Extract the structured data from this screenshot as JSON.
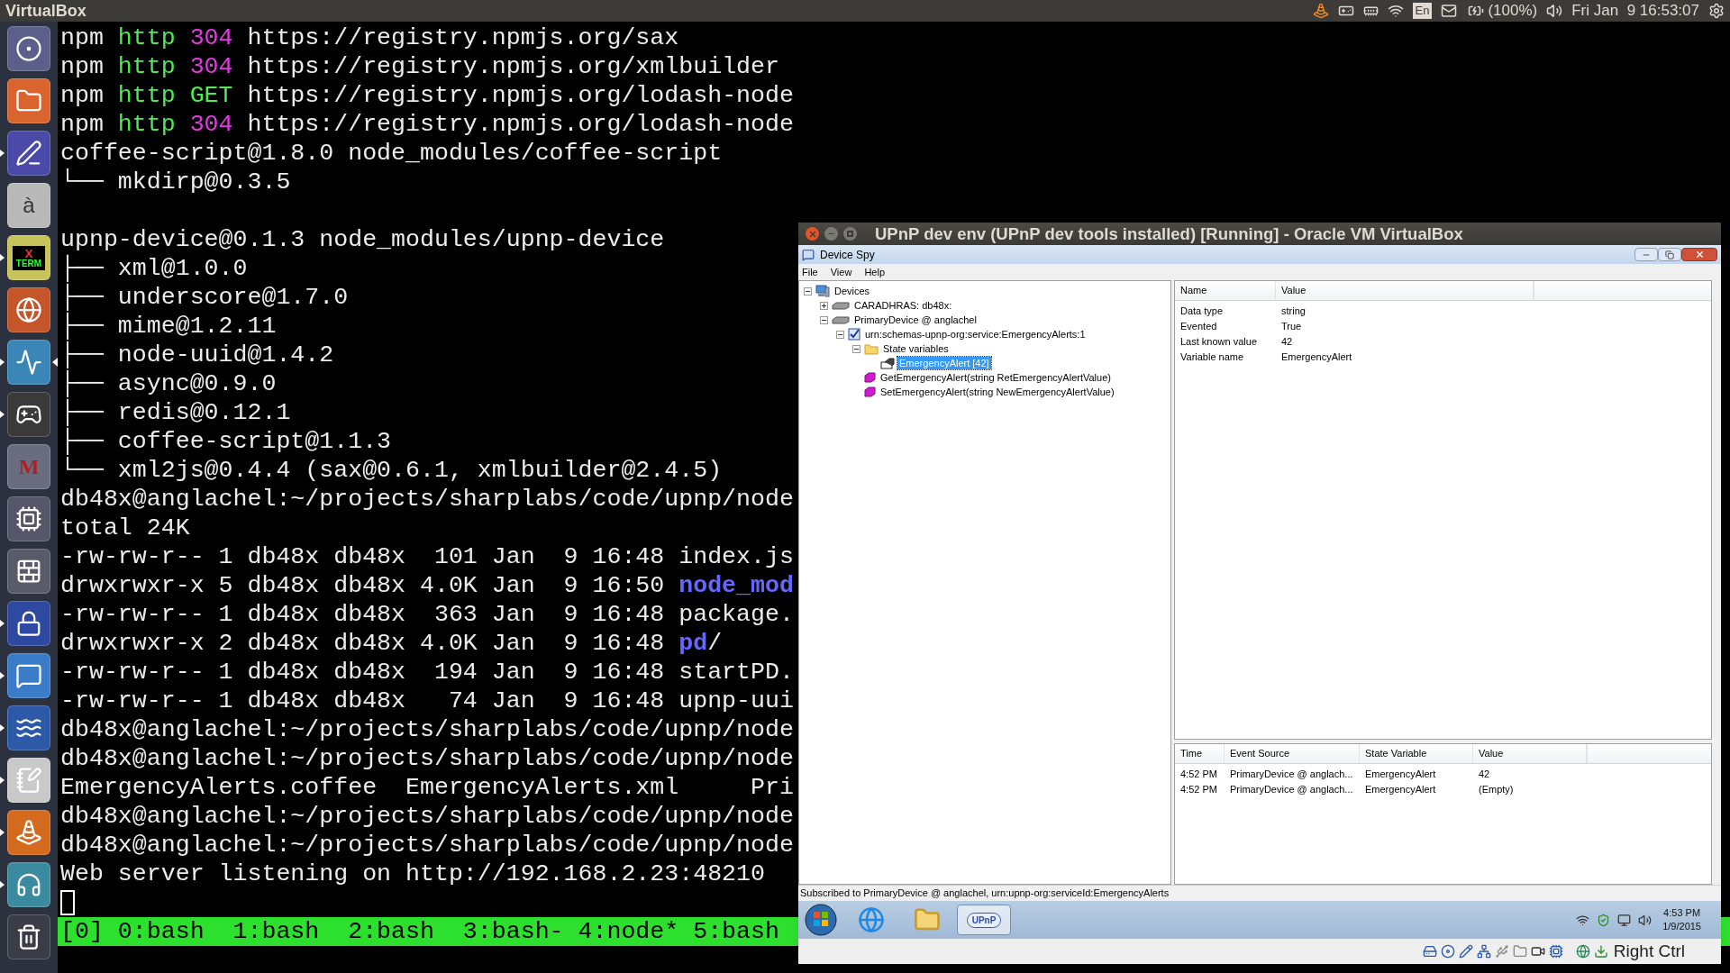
{
  "top_panel": {
    "app_title": "VirtualBox",
    "keyboard_layout": "En",
    "battery": "(100%)",
    "clock": "Fri Jan  9 16:53:07"
  },
  "launcher": {
    "items": [
      {
        "kind": "dash",
        "running": false,
        "focused": false
      },
      {
        "kind": "files",
        "running": false,
        "focused": false
      },
      {
        "kind": "editor",
        "running": true,
        "focused": false
      },
      {
        "kind": "font",
        "label": "à",
        "running": false,
        "focused": false
      },
      {
        "kind": "xterm",
        "label": "X",
        "sublabel": "TERM",
        "running": true,
        "focused": false
      },
      {
        "kind": "browser",
        "running": false,
        "focused": false
      },
      {
        "kind": "monitor",
        "running": true,
        "focused": true
      },
      {
        "kind": "steam",
        "running": true,
        "focused": false
      },
      {
        "kind": "maple",
        "label": "M",
        "running": false,
        "focused": false
      },
      {
        "kind": "circuit",
        "running": false,
        "focused": false
      },
      {
        "kind": "firewall",
        "running": false,
        "focused": false
      },
      {
        "kind": "keepass",
        "running": true,
        "focused": false
      },
      {
        "kind": "chat",
        "running": true,
        "focused": false
      },
      {
        "kind": "shark",
        "running": true,
        "focused": false
      },
      {
        "kind": "notes",
        "running": true,
        "focused": false
      },
      {
        "kind": "vlc",
        "running": true,
        "focused": false
      },
      {
        "kind": "teamspeak",
        "running": true,
        "focused": false
      },
      {
        "kind": "trash",
        "running": false,
        "focused": false
      }
    ]
  },
  "terminal": {
    "lines": [
      {
        "kind": "text",
        "segments": [
          {
            "text": "npm ",
            "kind": "plain"
          },
          {
            "text": "http ",
            "kind": "http"
          },
          {
            "text": "304 ",
            "kind": "code"
          },
          {
            "text": "https://registry.npmjs.org/sax",
            "kind": "plain"
          }
        ]
      },
      {
        "kind": "text",
        "segments": [
          {
            "text": "npm ",
            "kind": "plain"
          },
          {
            "text": "http ",
            "kind": "http"
          },
          {
            "text": "304 ",
            "kind": "code"
          },
          {
            "text": "https://registry.npmjs.org/xmlbuilder",
            "kind": "plain"
          }
        ]
      },
      {
        "kind": "text",
        "segments": [
          {
            "text": "npm ",
            "kind": "plain"
          },
          {
            "text": "http ",
            "kind": "http"
          },
          {
            "text": "GET ",
            "kind": "http"
          },
          {
            "text": "https://registry.npmjs.org/lodash-node",
            "kind": "plain"
          }
        ]
      },
      {
        "kind": "text",
        "segments": [
          {
            "text": "npm ",
            "kind": "plain"
          },
          {
            "text": "http ",
            "kind": "http"
          },
          {
            "text": "304 ",
            "kind": "code"
          },
          {
            "text": "https://registry.npmjs.org/lodash-node",
            "kind": "plain"
          }
        ]
      },
      {
        "kind": "text",
        "segments": [
          {
            "text": "coffee-script@1.8.0 node_modules/coffee-script",
            "kind": "plain"
          }
        ]
      },
      {
        "kind": "text",
        "segments": [
          {
            "text": "└── mkdirp@0.3.5",
            "kind": "plain"
          }
        ]
      },
      {
        "kind": "blank"
      },
      {
        "kind": "text",
        "segments": [
          {
            "text": "upnp-device@0.1.3 node_modules/upnp-device",
            "kind": "plain"
          }
        ]
      },
      {
        "kind": "text",
        "segments": [
          {
            "text": "├── xml@1.0.0",
            "kind": "plain"
          }
        ]
      },
      {
        "kind": "text",
        "segments": [
          {
            "text": "├── underscore@1.7.0",
            "kind": "plain"
          }
        ]
      },
      {
        "kind": "text",
        "segments": [
          {
            "text": "├── mime@1.2.11",
            "kind": "plain"
          }
        ]
      },
      {
        "kind": "text",
        "segments": [
          {
            "text": "├── node-uuid@1.4.2",
            "kind": "plain"
          }
        ]
      },
      {
        "kind": "text",
        "segments": [
          {
            "text": "├── async@0.9.0",
            "kind": "plain"
          }
        ]
      },
      {
        "kind": "text",
        "segments": [
          {
            "text": "├── redis@0.12.1",
            "kind": "plain"
          }
        ]
      },
      {
        "kind": "text",
        "segments": [
          {
            "text": "├── coffee-script@1.1.3",
            "kind": "plain"
          }
        ]
      },
      {
        "kind": "text",
        "segments": [
          {
            "text": "└── xml2js@0.4.4 (sax@0.6.1, xmlbuilder@2.4.5)",
            "kind": "plain"
          }
        ]
      },
      {
        "kind": "text",
        "segments": [
          {
            "text": "db48x@anglachel:~/projects/sharplabs/code/upnp/node",
            "kind": "plain"
          }
        ]
      },
      {
        "kind": "text",
        "segments": [
          {
            "text": "total 24K",
            "kind": "plain"
          }
        ]
      },
      {
        "kind": "text",
        "segments": [
          {
            "text": "-rw-rw-r-- 1 db48x db48x  101 Jan  9 16:48 index.js",
            "kind": "plain"
          }
        ]
      },
      {
        "kind": "text",
        "segments": [
          {
            "text": "drwxrwxr-x 5 db48x db48x 4.0K Jan  9 16:50 ",
            "kind": "plain"
          },
          {
            "text": "node_mod",
            "kind": "dir"
          }
        ]
      },
      {
        "kind": "text",
        "segments": [
          {
            "text": "-rw-rw-r-- 1 db48x db48x  363 Jan  9 16:48 package.",
            "kind": "plain"
          }
        ]
      },
      {
        "kind": "text",
        "segments": [
          {
            "text": "drwxrwxr-x 2 db48x db48x 4.0K Jan  9 16:48 ",
            "kind": "plain"
          },
          {
            "text": "pd",
            "kind": "dir"
          },
          {
            "text": "/",
            "kind": "plain"
          }
        ]
      },
      {
        "kind": "text",
        "segments": [
          {
            "text": "-rw-rw-r-- 1 db48x db48x  194 Jan  9 16:48 startPD.",
            "kind": "plain"
          }
        ]
      },
      {
        "kind": "text",
        "segments": [
          {
            "text": "-rw-rw-r-- 1 db48x db48x   74 Jan  9 16:48 upnp-uui",
            "kind": "plain"
          }
        ]
      },
      {
        "kind": "text",
        "segments": [
          {
            "text": "db48x@anglachel:~/projects/sharplabs/code/upnp/node",
            "kind": "plain"
          }
        ]
      },
      {
        "kind": "text",
        "segments": [
          {
            "text": "db48x@anglachel:~/projects/sharplabs/code/upnp/node",
            "kind": "plain"
          }
        ]
      },
      {
        "kind": "text",
        "segments": [
          {
            "text": "EmergencyAlerts.coffee  EmergencyAlerts.xml     Pri",
            "kind": "plain"
          }
        ]
      },
      {
        "kind": "text",
        "segments": [
          {
            "text": "db48x@anglachel:~/projects/sharplabs/code/upnp/node",
            "kind": "plain"
          }
        ]
      },
      {
        "kind": "text",
        "segments": [
          {
            "text": "db48x@anglachel:~/projects/sharplabs/code/upnp/node",
            "kind": "plain"
          }
        ]
      },
      {
        "kind": "text",
        "segments": [
          {
            "text": "Web server listening on http://192.168.2.23:48210",
            "kind": "plain"
          }
        ]
      },
      {
        "kind": "cursor"
      }
    ],
    "status_bar": "[0] 0:bash  1:bash  2:bash  3:bash- 4:node* 5:bash"
  },
  "vm_window": {
    "title": "UPnP dev env (UPnP dev tools installed) [Running] - Oracle VM VirtualBox",
    "app": {
      "title": "Device Spy",
      "menu": [
        "File",
        "View",
        "Help"
      ],
      "tree": [
        {
          "label": "Devices",
          "kind": "devices",
          "expanded": true,
          "selected": false,
          "children": [
            {
              "label": "CARADHRAS: db48x:",
              "kind": "device",
              "expanded": false,
              "selected": false
            },
            {
              "label": "PrimaryDevice @ anglachel",
              "kind": "device",
              "expanded": true,
              "selected": false,
              "children": [
                {
                  "label": "urn:schemas-upnp-org:service:EmergencyAlerts:1",
                  "kind": "service",
                  "expanded": true,
                  "selected": false,
                  "children": [
                    {
                      "label": "State variables",
                      "kind": "folder",
                      "expanded": true,
                      "selected": false,
                      "children": [
                        {
                          "label": "EmergencyAlert [42]",
                          "kind": "variable",
                          "selected": true
                        }
                      ]
                    },
                    {
                      "label": "GetEmergencyAlert(string RetEmergencyAlertValue)",
                      "kind": "action",
                      "selected": false
                    },
                    {
                      "label": "SetEmergencyAlert(string NewEmergencyAlertValue)",
                      "kind": "action",
                      "selected": false
                    }
                  ]
                }
              ]
            }
          ]
        }
      ],
      "properties": {
        "columns": [
          "Name",
          "Value"
        ],
        "rows": [
          [
            "Data type",
            "string"
          ],
          [
            "Evented",
            "True"
          ],
          [
            "Last known value",
            "42"
          ],
          [
            "Variable name",
            "EmergencyAlert"
          ]
        ]
      },
      "events": {
        "columns": [
          "Time",
          "Event Source",
          "State Variable",
          "Value"
        ],
        "rows": [
          [
            "4:52 PM",
            "PrimaryDevice @ anglach...",
            "EmergencyAlert",
            "42"
          ],
          [
            "4:52 PM",
            "PrimaryDevice @ anglach...",
            "EmergencyAlert",
            "(Empty)"
          ]
        ]
      },
      "status_text": "Subscribed to PrimaryDevice @ anglachel, urn:upnp-org:serviceId:EmergencyAlerts"
    },
    "guest_taskbar": {
      "items": [
        {
          "kind": "start",
          "selected": false
        },
        {
          "kind": "browser",
          "selected": false
        },
        {
          "kind": "explorer",
          "selected": false
        },
        {
          "kind": "app",
          "label": "UPnP",
          "selected": true
        }
      ],
      "time": "4:53 PM",
      "date": "1/9/2015"
    },
    "host_key": "Right Ctrl"
  }
}
